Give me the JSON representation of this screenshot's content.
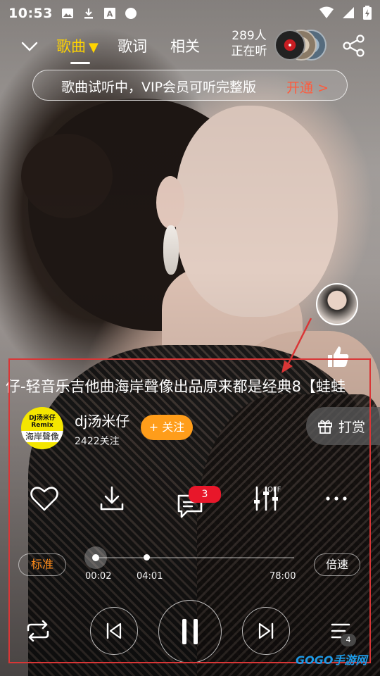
{
  "status_bar": {
    "time": "10:53"
  },
  "nav": {
    "tabs": [
      {
        "label": "歌曲",
        "marker": "▼"
      },
      {
        "label": "歌词"
      },
      {
        "label": "相关"
      }
    ],
    "listeners_count": "289人",
    "listeners_label": "正在听"
  },
  "vip_banner": {
    "message": "歌曲试听中，VIP会员可听完整版",
    "action": "开通 >"
  },
  "song": {
    "title": "仔-轻音乐吉他曲海岸聲像出品原来都是经典8【蛙蛙"
  },
  "artist": {
    "name": "dj汤米仔",
    "followers": "2422关注",
    "follow_label": "+ 关注",
    "avatar_text": [
      "DJ汤米仔",
      "Remix",
      "海岸聲像"
    ]
  },
  "reward": {
    "label": "打赏"
  },
  "actions": {
    "comment_count": "3",
    "eq_state": "OFF"
  },
  "progress": {
    "quality_label": "标准",
    "speed_label": "倍速",
    "current_time": "00:02",
    "preview_end": "04:01",
    "total_time": "78:00",
    "played_fraction": 0.0,
    "buffer_fraction": 0.051
  },
  "playlist": {
    "count": "4"
  },
  "colors": {
    "accent_yellow": "#ffd400",
    "vip_red": "#ff5a3c",
    "follow_orange": "#ff9d1a",
    "badge_red": "#e8172a",
    "annotation_red": "#d93636"
  },
  "watermark": "GOGO手游网"
}
